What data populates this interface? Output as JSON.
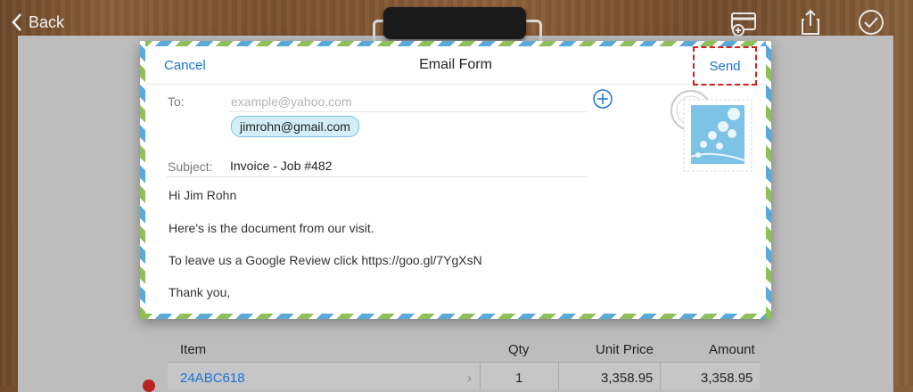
{
  "topbar": {
    "back_label": "Back"
  },
  "dialog": {
    "title": "Email Form",
    "cancel_label": "Cancel",
    "send_label": "Send",
    "to_label": "To:",
    "to_placeholder": "example@yahoo.com",
    "recipients": [
      "jimrohn@gmail.com"
    ],
    "subject_label": "Subject:",
    "subject_value": "Invoice - Job #482",
    "body_lines": [
      "Hi Jim Rohn",
      "Here's is the document from our visit.",
      "To leave us a Google Review click https://goo.gl/7YgXsN",
      "Thank you,"
    ]
  },
  "table": {
    "headers": {
      "item": "Item",
      "qty": "Qty",
      "unit_price": "Unit Price",
      "amount": "Amount"
    },
    "rows": [
      {
        "item": "24ABC618",
        "qty": "1",
        "unit_price": "3,358.95",
        "amount": "3,358.95"
      }
    ]
  },
  "icons": {
    "back": "chevron-left-icon",
    "card": "credit-card-add-icon",
    "share": "share-icon",
    "done": "checkmark-circle-icon",
    "add_recipient": "plus-circle-icon",
    "stamp": "postage-stamp-icon"
  },
  "colors": {
    "accent": "#1a73d9",
    "highlight": "#d21f1f",
    "chip_bg": "#d4eef8"
  }
}
